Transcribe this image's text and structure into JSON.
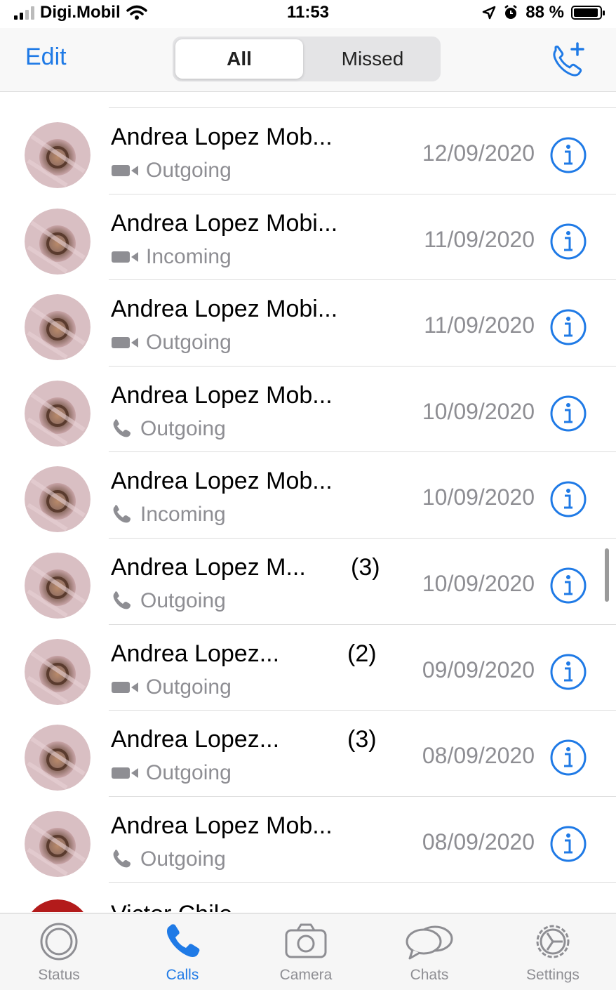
{
  "status_bar": {
    "carrier": "Digi.Mobil",
    "time": "11:53",
    "battery": "88 %",
    "battery_level": 0.88
  },
  "nav": {
    "edit_label": "Edit",
    "segments": [
      "All",
      "Missed"
    ],
    "selected_segment": "All",
    "new_call_icon": "phone-plus-icon"
  },
  "calls": [
    {
      "name": "Andrea Lopez Mob...",
      "count": "",
      "type": "video",
      "direction": "Outgoing",
      "date": "12/09/2020"
    },
    {
      "name": "Andrea Lopez Mobi...",
      "count": "",
      "type": "video",
      "direction": "Incoming",
      "date": "11/09/2020"
    },
    {
      "name": "Andrea Lopez Mobi...",
      "count": "",
      "type": "video",
      "direction": "Outgoing",
      "date": "11/09/2020"
    },
    {
      "name": "Andrea Lopez Mob...",
      "count": "",
      "type": "voice",
      "direction": "Outgoing",
      "date": "10/09/2020"
    },
    {
      "name": "Andrea Lopez Mob...",
      "count": "",
      "type": "voice",
      "direction": "Incoming",
      "date": "10/09/2020"
    },
    {
      "name": "Andrea Lopez M...",
      "count": "(3)",
      "type": "voice",
      "direction": "Outgoing",
      "date": "10/09/2020"
    },
    {
      "name": "Andrea Lopez...",
      "count": "(2)",
      "type": "video",
      "direction": "Outgoing",
      "date": "09/09/2020"
    },
    {
      "name": "Andrea Lopez...",
      "count": "(3)",
      "type": "video",
      "direction": "Outgoing",
      "date": "08/09/2020"
    },
    {
      "name": "Andrea Lopez Mob...",
      "count": "",
      "type": "voice",
      "direction": "Outgoing",
      "date": "08/09/2020"
    }
  ],
  "partial_call": {
    "name": "Victor Chile"
  },
  "tabs": [
    {
      "label": "Status",
      "icon": "status-icon",
      "active": false
    },
    {
      "label": "Calls",
      "icon": "phone-icon",
      "active": true
    },
    {
      "label": "Camera",
      "icon": "camera-icon",
      "active": false
    },
    {
      "label": "Chats",
      "icon": "chats-icon",
      "active": false
    },
    {
      "label": "Settings",
      "icon": "gear-icon",
      "active": false
    }
  ],
  "colors": {
    "accent": "#1f7ae6",
    "secondary_text": "#8e8e93"
  }
}
